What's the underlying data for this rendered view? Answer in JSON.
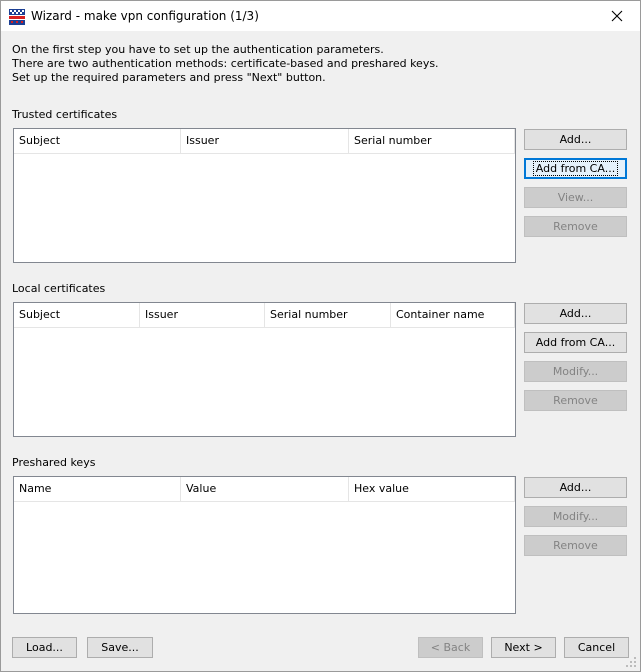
{
  "window": {
    "title": "Wizard - make vpn configuration (1/3)"
  },
  "intro": {
    "line1": "On the first step you have to set up the authentication parameters.",
    "line2": "There are two authentication methods: certificate-based and preshared keys.",
    "line3": "Set up the required parameters and press \"Next\" button."
  },
  "trusted": {
    "label": "Trusted certificates",
    "columns": [
      "Subject",
      "Issuer",
      "Serial number"
    ],
    "buttons": {
      "add": "Add...",
      "add_from_ca": "Add from CA...",
      "view": "View...",
      "remove": "Remove"
    }
  },
  "local": {
    "label": "Local certificates",
    "columns": [
      "Subject",
      "Issuer",
      "Serial number",
      "Container name"
    ],
    "buttons": {
      "add": "Add...",
      "add_from_ca": "Add from CA...",
      "modify": "Modify...",
      "remove": "Remove"
    }
  },
  "preshared": {
    "label": "Preshared keys",
    "columns": [
      "Name",
      "Value",
      "Hex value"
    ],
    "buttons": {
      "add": "Add...",
      "modify": "Modify...",
      "remove": "Remove"
    }
  },
  "footer": {
    "load": "Load...",
    "save": "Save...",
    "back": "< Back",
    "next": "Next >",
    "cancel": "Cancel"
  },
  "colors": {
    "focus_border": "#0078d7",
    "disabled_text": "#838383"
  }
}
